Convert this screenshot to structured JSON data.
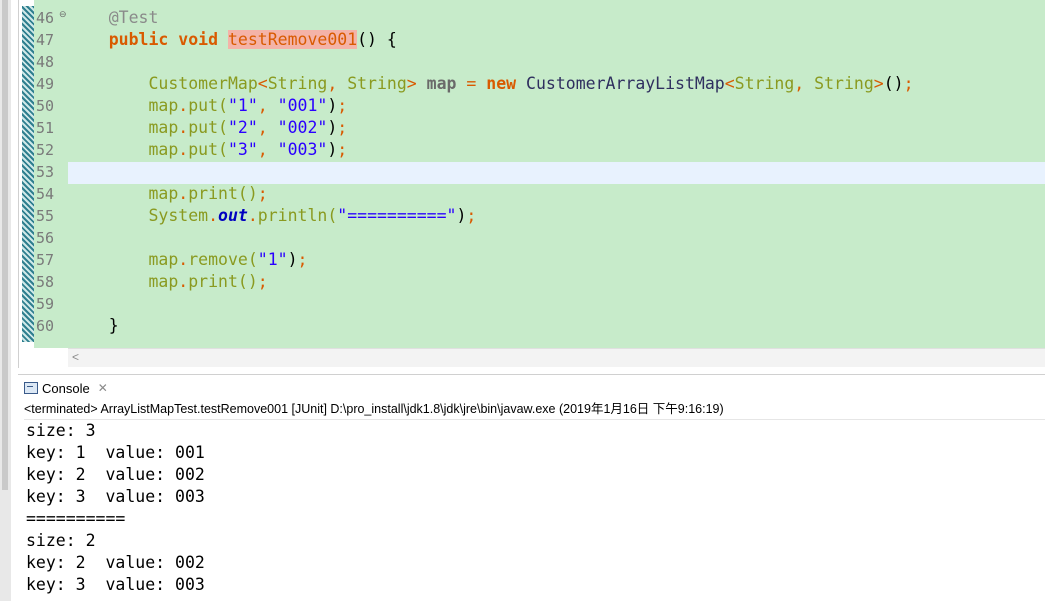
{
  "editor": {
    "line_numbers": [
      "46",
      "47",
      "48",
      "49",
      "50",
      "51",
      "52",
      "53",
      "54",
      "55",
      "56",
      "57",
      "58",
      "59",
      "60"
    ],
    "code": {
      "l46": {
        "annotation": "@Test"
      },
      "l47": {
        "kw1": "public",
        "kw2": "void",
        "method": "testRemove001",
        "rest": "() {"
      },
      "l49": {
        "type1": "CustomerMap",
        "lt": "<",
        "t1": "String",
        "comma": ",",
        "t2": "String",
        "gt": ">",
        "var": "map",
        "eq": "=",
        "new": "new",
        "cls": "CustomerArrayListMap",
        "lt2": "<",
        "t3": "String",
        "comma2": ",",
        "t4": "String",
        "gt2": ">",
        "tail": "()",
        "semi": ";"
      },
      "l50": {
        "obj": "map",
        "dot": ".",
        "call": "put(",
        "a1": "\"1\"",
        "comma": ",",
        "a2": "\"001\"",
        "close": ")",
        "semi": ";"
      },
      "l51": {
        "obj": "map",
        "dot": ".",
        "call": "put(",
        "a1": "\"2\"",
        "comma": ",",
        "a2": "\"002\"",
        "close": ")",
        "semi": ";"
      },
      "l52": {
        "obj": "map",
        "dot": ".",
        "call": "put(",
        "a1": "\"3\"",
        "comma": ",",
        "a2": "\"003\"",
        "close": ")",
        "semi": ";"
      },
      "l54": {
        "obj": "map",
        "dot": ".",
        "call": "print()",
        "semi": ";"
      },
      "l55": {
        "obj": "System",
        "dot": ".",
        "field": "out",
        "dot2": ".",
        "call": "println(",
        "arg": "\"==========\"",
        "close": ")",
        "semi": ";"
      },
      "l57": {
        "obj": "map",
        "dot": ".",
        "call": "remove(",
        "arg": "\"1\"",
        "close": ")",
        "semi": ";"
      },
      "l58": {
        "obj": "map",
        "dot": ".",
        "call": "print()",
        "semi": ";"
      },
      "l60": {
        "brace": "}"
      }
    }
  },
  "console": {
    "tab_label": "Console",
    "close_glyph": "✕",
    "description": "<terminated> ArrayListMapTest.testRemove001 [JUnit] D:\\pro_install\\jdk1.8\\jdk\\jre\\bin\\javaw.exe (2019年1月16日 下午9:16:19)",
    "output": [
      "size: 3",
      "key: 1  value: 001",
      "key: 2  value: 002",
      "key: 3  value: 003",
      "==========",
      "size: 2",
      "key: 2  value: 002",
      "key: 3  value: 003"
    ]
  },
  "colors": {
    "editor_background": "#c7ebca",
    "current_line": "#e8f2fe",
    "keyword": "#d95a00",
    "string": "#2a00ff",
    "occurrence_highlight": "#f4b3a8"
  },
  "icons": [
    "console-icon",
    "close-icon",
    "scroll-left-icon",
    "fold-icon"
  ]
}
